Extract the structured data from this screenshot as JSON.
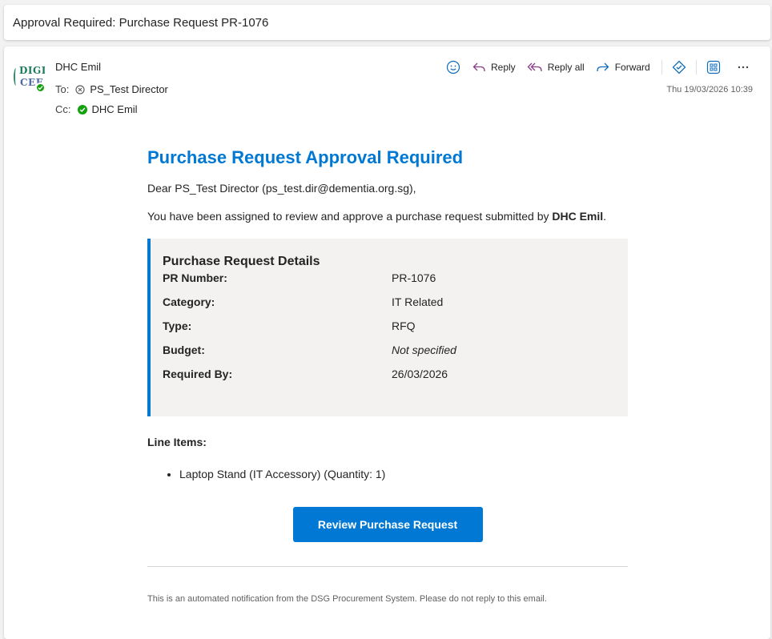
{
  "subject": "Approval Required: Purchase Request PR-1076",
  "header": {
    "sender": "DHC Emil",
    "avatar_text_1": "DIGI",
    "avatar_text_2": "CEF",
    "to_label": "To:",
    "to_recipient": "PS_Test Director",
    "cc_label": "Cc:",
    "cc_recipient": "DHC Emil",
    "date": "Thu 19/03/2026 10:39"
  },
  "toolbar": {
    "reply": "Reply",
    "reply_all": "Reply all",
    "forward": "Forward",
    "icons": [
      "emoji-icon",
      "reply-icon",
      "reply-all-icon",
      "forward-icon",
      "loop-icon",
      "apps-icon",
      "more-icon"
    ]
  },
  "body": {
    "heading": "Purchase Request Approval Required",
    "greeting": "Dear PS_Test Director (ps_test.dir@dementia.org.sg),",
    "intro_text": "You have been assigned to review and approve a purchase request submitted by ",
    "intro_name": "DHC Emil",
    "intro_end": ".",
    "details_title": "Purchase Request Details",
    "details": [
      {
        "key": "PR Number:",
        "value": "PR-1076"
      },
      {
        "key": "Category:",
        "value": "IT Related"
      },
      {
        "key": "Type:",
        "value": "RFQ"
      },
      {
        "key": "Budget:",
        "value": "Not specified"
      },
      {
        "key": "Required By:",
        "value": "26/03/2026"
      }
    ],
    "line_items_title": "Line Items:",
    "line_items": [
      "Laptop Stand (IT Accessory) (Quantity: 1)"
    ],
    "button_label": "Review Purchase Request",
    "footer": "This is an automated notification from the DSG Procurement System. Please do not reply to this email."
  },
  "colors": {
    "accent": "#0078d4",
    "presence_green": "#13a10e",
    "details_bg": "#f3f2f1",
    "reply_icon": "#8a3b86",
    "toolbar_icon": "#0f6cbd"
  }
}
